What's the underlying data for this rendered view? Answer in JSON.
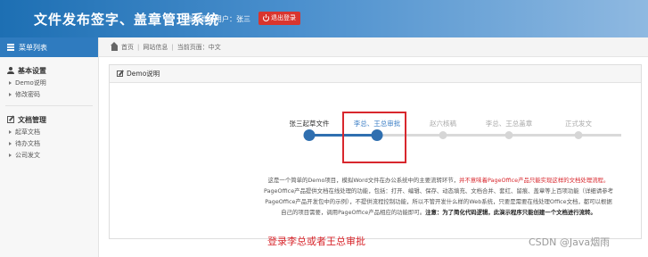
{
  "header": {
    "app_title": "文件发布签字、盖章管理系统",
    "login_label": "当前登录用户：张三",
    "logout_label": "退出登录"
  },
  "sidebar": {
    "heading": "菜单列表",
    "sections": [
      {
        "title": "基本设置",
        "icon": "user-icon",
        "items": [
          "Demo说明",
          "修改密码"
        ]
      },
      {
        "title": "文档管理",
        "icon": "edit-icon",
        "items": [
          "起草文档",
          "待办文档",
          "公司发文"
        ]
      }
    ]
  },
  "breadcrumb": {
    "home": "首页",
    "items": [
      "网站信息",
      "当前页面：中文"
    ]
  },
  "panel": {
    "title": "Demo说明",
    "steps": [
      {
        "label": "张三起草文件",
        "state": "done"
      },
      {
        "label": "李总、王总审批",
        "state": "current"
      },
      {
        "label": "赵六核稿",
        "state": "pending"
      },
      {
        "label": "李总、王总盖章",
        "state": "pending"
      },
      {
        "label": "正式发文",
        "state": "pending"
      }
    ],
    "description": {
      "line1_a": "这是一个简单的Demo项目，模拟Word文件在办公系统中的主要流转环节，",
      "line1_b": "并不意味着PageOffice产品只能实现这样的文档处理流程。",
      "line2": "PageOffice产品提供文档在线处理的功能，包括：打开、编辑、保存、动态填充、文档合并、套红、留痕、盖章等上百项功能（详细请参考",
      "line3": "PageOffice产品开发包中的示例），不提供流程控制功能，所以不管开发什么样的Web系统，只要是需要在线处理Office文档，都可以根据",
      "line4_a": "自己的项目需要，调用PageOffice产品相应的功能即可。",
      "line4_b": "注意：为了简化代码逻辑，此演示程序只能创建一个文档进行流转。"
    }
  },
  "annotation": "登录李总或者王总审批",
  "watermark": "CSDN @Java烟雨",
  "colors": {
    "accent": "#2f6fb0",
    "highlight": "#d8272d",
    "logout": "#d9352e"
  }
}
